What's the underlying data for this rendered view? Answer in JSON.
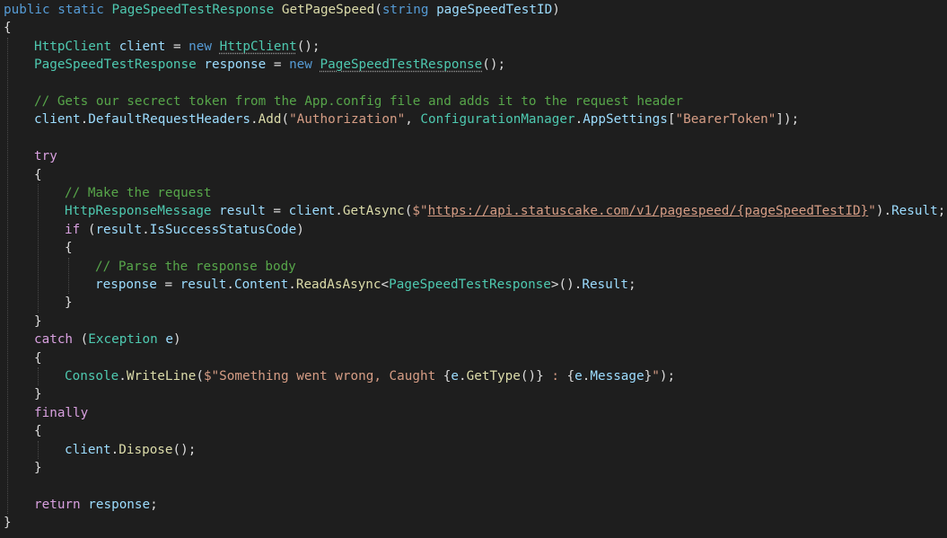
{
  "editor": {
    "background": "#1e1e1e",
    "palette": {
      "keyword": "#569cd6",
      "type": "#4ec9b0",
      "method": "#dcdcaa",
      "identifier": "#9cdcfe",
      "plain": "#dcdcdc",
      "string": "#d69d85",
      "comment": "#57a64a",
      "control_keyword": "#d8a0df"
    },
    "lines": [
      {
        "indent": 0,
        "tokens": [
          [
            "kw",
            "public"
          ],
          [
            "pl",
            " "
          ],
          [
            "kw",
            "static"
          ],
          [
            "pl",
            " "
          ],
          [
            "ty",
            "PageSpeedTestResponse"
          ],
          [
            "pl",
            " "
          ],
          [
            "fn",
            "GetPageSpeed"
          ],
          [
            "pl",
            "("
          ],
          [
            "kw",
            "string"
          ],
          [
            "pl",
            " "
          ],
          [
            "id",
            "pageSpeedTestID"
          ],
          [
            "pl",
            ")"
          ]
        ]
      },
      {
        "indent": 0,
        "tokens": [
          [
            "pl",
            "{"
          ]
        ]
      },
      {
        "indent": 1,
        "tokens": [
          [
            "ty",
            "HttpClient"
          ],
          [
            "pl",
            " "
          ],
          [
            "id",
            "client"
          ],
          [
            "pl",
            " = "
          ],
          [
            "kw",
            "new"
          ],
          [
            "pl",
            " "
          ],
          [
            "tysq",
            "HttpClient"
          ],
          [
            "pl",
            "();"
          ]
        ]
      },
      {
        "indent": 1,
        "tokens": [
          [
            "ty",
            "PageSpeedTestResponse"
          ],
          [
            "pl",
            " "
          ],
          [
            "id",
            "response"
          ],
          [
            "pl",
            " = "
          ],
          [
            "kw",
            "new"
          ],
          [
            "pl",
            " "
          ],
          [
            "tysq",
            "PageSpeedTestResponse"
          ],
          [
            "pl",
            "();"
          ]
        ]
      },
      {
        "indent": 0,
        "tokens": []
      },
      {
        "indent": 1,
        "tokens": [
          [
            "cm",
            "// Gets our secrect token from the App.config file and adds it to the request header"
          ]
        ]
      },
      {
        "indent": 1,
        "tokens": [
          [
            "id",
            "client"
          ],
          [
            "pl",
            "."
          ],
          [
            "id",
            "DefaultRequestHeaders"
          ],
          [
            "pl",
            "."
          ],
          [
            "fn",
            "Add"
          ],
          [
            "pl",
            "("
          ],
          [
            "st",
            "\"Authorization\""
          ],
          [
            "pl",
            ", "
          ],
          [
            "ty",
            "ConfigurationManager"
          ],
          [
            "pl",
            "."
          ],
          [
            "id",
            "AppSettings"
          ],
          [
            "pl",
            "["
          ],
          [
            "st",
            "\"BearerToken\""
          ],
          [
            "pl",
            "]);"
          ]
        ]
      },
      {
        "indent": 0,
        "tokens": []
      },
      {
        "indent": 1,
        "tokens": [
          [
            "fk",
            "try"
          ]
        ]
      },
      {
        "indent": 1,
        "tokens": [
          [
            "pl",
            "{"
          ]
        ]
      },
      {
        "indent": 2,
        "tokens": [
          [
            "cm",
            "// Make the request"
          ]
        ]
      },
      {
        "indent": 2,
        "tokens": [
          [
            "ty",
            "HttpResponseMessage"
          ],
          [
            "pl",
            " "
          ],
          [
            "id",
            "result"
          ],
          [
            "pl",
            " = "
          ],
          [
            "id",
            "client"
          ],
          [
            "pl",
            "."
          ],
          [
            "fn",
            "GetAsync"
          ],
          [
            "pl",
            "("
          ],
          [
            "st",
            "$\""
          ],
          [
            "url",
            "https://api.statuscake.com/v1/pagespeed/{pageSpeedTestID}"
          ],
          [
            "st",
            "\""
          ],
          [
            "pl",
            ")."
          ],
          [
            "id",
            "Result"
          ],
          [
            "pl",
            ";"
          ]
        ]
      },
      {
        "indent": 2,
        "tokens": [
          [
            "fk",
            "if"
          ],
          [
            "pl",
            " ("
          ],
          [
            "id",
            "result"
          ],
          [
            "pl",
            "."
          ],
          [
            "id",
            "IsSuccessStatusCode"
          ],
          [
            "pl",
            ")"
          ]
        ]
      },
      {
        "indent": 2,
        "tokens": [
          [
            "pl",
            "{"
          ]
        ]
      },
      {
        "indent": 3,
        "tokens": [
          [
            "cm",
            "// Parse the response body"
          ]
        ]
      },
      {
        "indent": 3,
        "tokens": [
          [
            "id",
            "response"
          ],
          [
            "pl",
            " = "
          ],
          [
            "id",
            "result"
          ],
          [
            "pl",
            "."
          ],
          [
            "id",
            "Content"
          ],
          [
            "pl",
            "."
          ],
          [
            "fn",
            "ReadAsAsync"
          ],
          [
            "pl",
            "<"
          ],
          [
            "ty",
            "PageSpeedTestResponse"
          ],
          [
            "pl",
            ">()."
          ],
          [
            "id",
            "Result"
          ],
          [
            "pl",
            ";"
          ]
        ]
      },
      {
        "indent": 2,
        "tokens": [
          [
            "pl",
            "}"
          ]
        ]
      },
      {
        "indent": 1,
        "tokens": [
          [
            "pl",
            "}"
          ]
        ]
      },
      {
        "indent": 1,
        "tokens": [
          [
            "fk",
            "catch"
          ],
          [
            "pl",
            " ("
          ],
          [
            "ty",
            "Exception"
          ],
          [
            "pl",
            " "
          ],
          [
            "id",
            "e"
          ],
          [
            "pl",
            ")"
          ]
        ]
      },
      {
        "indent": 1,
        "tokens": [
          [
            "pl",
            "{"
          ]
        ]
      },
      {
        "indent": 2,
        "tokens": [
          [
            "ty",
            "Console"
          ],
          [
            "pl",
            "."
          ],
          [
            "fn",
            "WriteLine"
          ],
          [
            "pl",
            "("
          ],
          [
            "st",
            "$\"Something went wrong, Caught "
          ],
          [
            "pl",
            "{"
          ],
          [
            "id",
            "e"
          ],
          [
            "pl",
            "."
          ],
          [
            "fn",
            "GetType"
          ],
          [
            "pl",
            "()}"
          ],
          [
            "st",
            " : "
          ],
          [
            "pl",
            "{"
          ],
          [
            "id",
            "e"
          ],
          [
            "pl",
            "."
          ],
          [
            "id",
            "Message"
          ],
          [
            "pl",
            "}"
          ],
          [
            "st",
            "\""
          ],
          [
            "pl",
            ");"
          ]
        ]
      },
      {
        "indent": 1,
        "tokens": [
          [
            "pl",
            "}"
          ]
        ]
      },
      {
        "indent": 1,
        "tokens": [
          [
            "fk",
            "finally"
          ]
        ]
      },
      {
        "indent": 1,
        "tokens": [
          [
            "pl",
            "{"
          ]
        ]
      },
      {
        "indent": 2,
        "tokens": [
          [
            "id",
            "client"
          ],
          [
            "pl",
            "."
          ],
          [
            "fn",
            "Dispose"
          ],
          [
            "pl",
            "();"
          ]
        ]
      },
      {
        "indent": 1,
        "tokens": [
          [
            "pl",
            "}"
          ]
        ]
      },
      {
        "indent": 0,
        "tokens": []
      },
      {
        "indent": 1,
        "tokens": [
          [
            "fk",
            "return"
          ],
          [
            "pl",
            " "
          ],
          [
            "id",
            "response"
          ],
          [
            "pl",
            ";"
          ]
        ]
      },
      {
        "indent": 0,
        "tokens": [
          [
            "pl",
            "}"
          ]
        ]
      }
    ]
  }
}
